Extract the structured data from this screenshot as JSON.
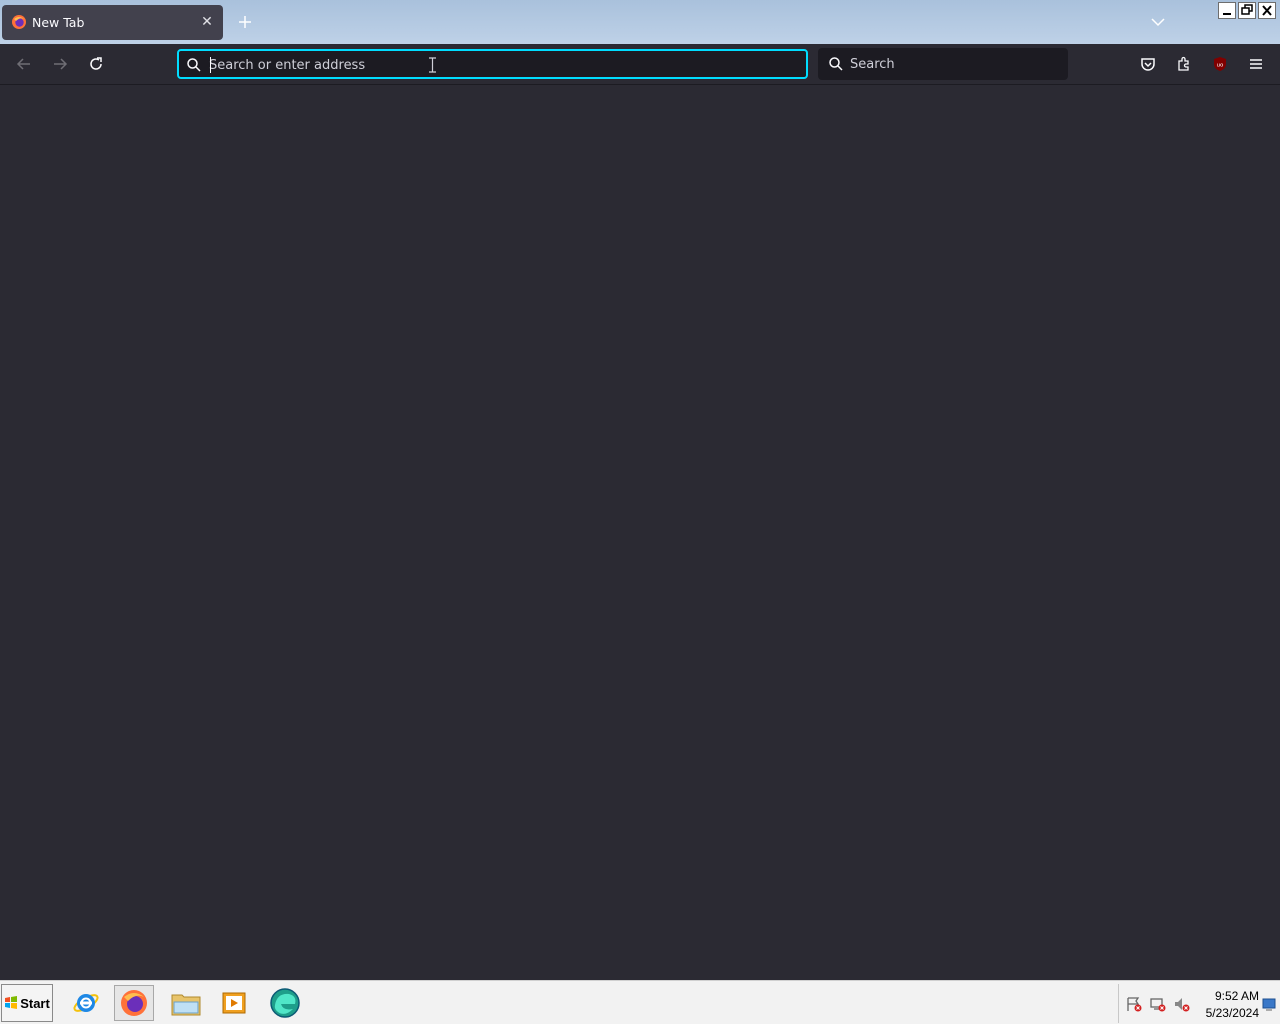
{
  "browser": {
    "tab": {
      "title": "New Tab",
      "close_label": "✕"
    },
    "urlbar": {
      "placeholder": "Search or enter address",
      "value": ""
    },
    "searchbar": {
      "placeholder": "Search"
    },
    "extension_badge": "uo"
  },
  "taskbar": {
    "start_label": "Start",
    "apps": [
      "internet-explorer",
      "firefox",
      "file-explorer",
      "media-player",
      "edge"
    ],
    "active_app": "firefox",
    "clock": {
      "time": "9:52 AM",
      "date": "5/23/2024"
    }
  },
  "colors": {
    "accent": "#00ddff",
    "toolbar": "#2b2a33",
    "field": "#1c1b22"
  }
}
